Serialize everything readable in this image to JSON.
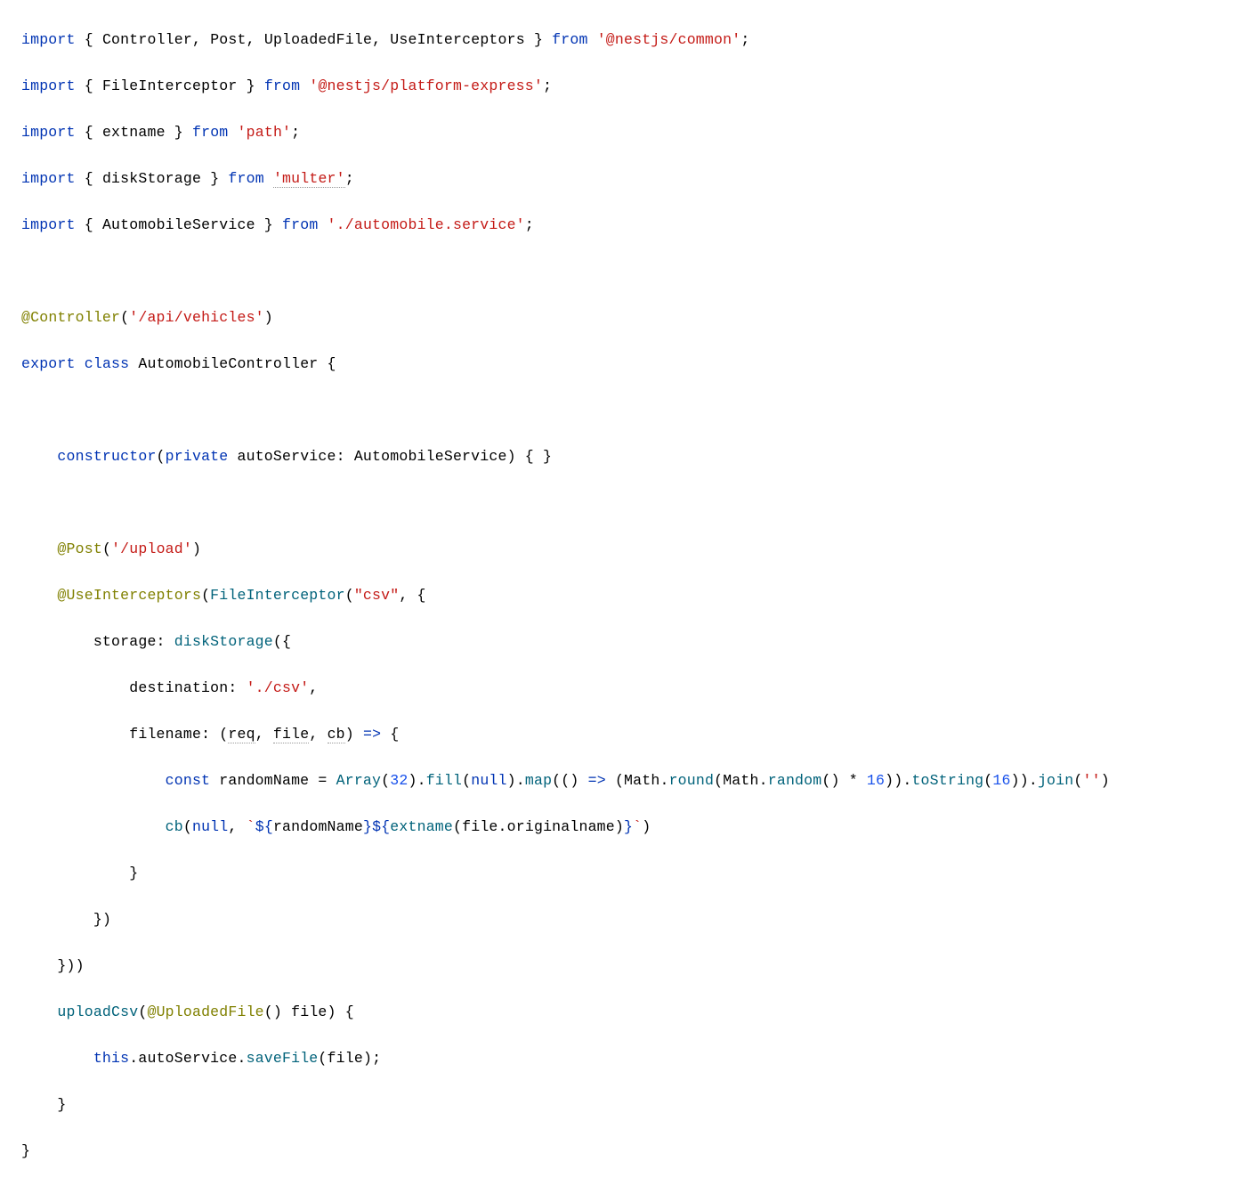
{
  "code": {
    "l1": {
      "import": "import",
      "lb": "{",
      "s1": "Controller",
      "c": ",",
      "s2": "Post",
      "s3": "UploadedFile",
      "s4": "UseInterceptors",
      "rb": "}",
      "from": "from",
      "mod": "'@nestjs/common'",
      "semi": ";"
    },
    "l2": {
      "import": "import",
      "lb": "{",
      "s1": "FileInterceptor",
      "rb": "}",
      "from": "from",
      "mod": "'@nestjs/platform-express'",
      "semi": ";"
    },
    "l3": {
      "import": "import",
      "lb": "{",
      "s1": "extname",
      "rb": "}",
      "from": "from",
      "mod": "'path'",
      "semi": ";"
    },
    "l4": {
      "import": "import",
      "lb": "{",
      "s1": "diskStorage",
      "rb": "}",
      "from": "from",
      "mod": "'multer'",
      "semi": ";"
    },
    "l5": {
      "import": "import",
      "lb": "{",
      "s1": "AutomobileService",
      "rb": "}",
      "from": "from",
      "mod": "'./automobile.service'",
      "semi": ";"
    },
    "l7": {
      "at": "@",
      "dec": "Controller",
      "lp": "(",
      "arg": "'/api/vehicles'",
      "rp": ")"
    },
    "l8": {
      "export": "export",
      "class": "class",
      "name": "AutomobileController",
      "lb": "{"
    },
    "l10": {
      "ctor": "constructor",
      "lp": "(",
      "priv": "private",
      "param": "autoService",
      "colon": ":",
      "type": "AutomobileService",
      "rp": ")",
      "lb": "{",
      "rb": "}"
    },
    "l12": {
      "at": "@",
      "dec": "Post",
      "lp": "(",
      "arg": "'/upload'",
      "rp": ")"
    },
    "l13": {
      "at": "@",
      "dec": "UseInterceptors",
      "lp": "(",
      "fi": "FileInterceptor",
      "lp2": "(",
      "arg": "\"csv\"",
      "c": ",",
      "lb": "{"
    },
    "l14": {
      "key": "storage",
      "colon": ":",
      "fn": "diskStorage",
      "lp": "(",
      "lb": "{"
    },
    "l15": {
      "key": "destination",
      "colon": ":",
      "val": "'./csv'",
      "c": ","
    },
    "l16": {
      "key": "filename",
      "colon": ":",
      "lp": "(",
      "p1": "req",
      "c": ",",
      "p2": "file",
      "p3": "cb",
      "rp": ")",
      "arrow": "=>",
      "lb": "{"
    },
    "l17": {
      "const": "const",
      "name": "randomName",
      "eq": "=",
      "Array": "Array",
      "lp": "(",
      "n32": "32",
      "rp": ")",
      "dot": ".",
      "fill": "fill",
      "lp2": "(",
      "null": "null",
      "rp2": ")",
      "map": "map",
      "lp3": "(",
      "lp4": "(",
      "rp4": ")",
      "arrow": "=>",
      "lp5": "(",
      "Math": "Math",
      "round": "round",
      "random": "random",
      "lp6": "(",
      "rp6": ")",
      "star": "*",
      "n16": "16",
      "rp7": ")",
      "rp8": ")",
      "toString": "toString",
      "lp9": "(",
      "n16b": "16",
      "rp9": ")",
      "rp10": ")",
      "join": "join",
      "lp11": "(",
      "empty": "''",
      "rp11": ")"
    },
    "l18": {
      "cb": "cb",
      "lp": "(",
      "null": "null",
      "c": ",",
      "bt": "`",
      "d1": "${",
      "rn": "randomName",
      "d2": "}",
      "d3": "${",
      "ext": "extname",
      "lp2": "(",
      "file": "file",
      "dot": ".",
      "orig": "originalname",
      "rp2": ")",
      "d4": "}",
      "bt2": "`",
      "rp": ")"
    },
    "l19": {
      "rb": "}"
    },
    "l20": {
      "rb": "}",
      "rp": ")"
    },
    "l21": {
      "rb": "}",
      "rp": ")",
      "rp2": ")"
    },
    "l22": {
      "fn": "uploadCsv",
      "lp": "(",
      "at": "@",
      "dec": "UploadedFile",
      "lp2": "(",
      "rp2": ")",
      "param": "file",
      "rp": ")",
      "lb": "{"
    },
    "l23": {
      "this": "this",
      "dot": ".",
      "svc": "autoService",
      "save": "saveFile",
      "lp": "(",
      "file": "file",
      "rp": ")",
      "semi": ";"
    },
    "l24": {
      "rb": "}"
    },
    "l25": {
      "rb": "}"
    }
  }
}
